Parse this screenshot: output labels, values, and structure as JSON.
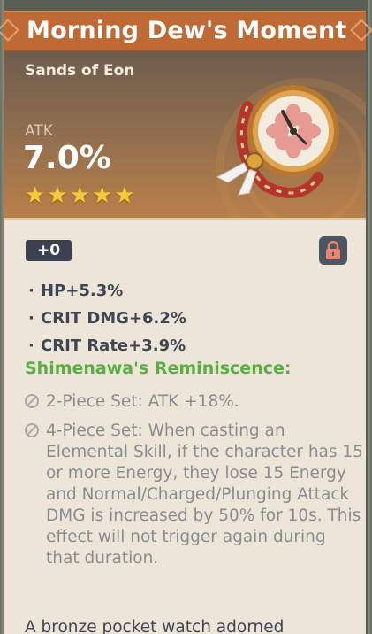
{
  "title": "Morning Dew's Moment",
  "set_name": "Sands of Eon",
  "main_stat": {
    "label": "ATK",
    "value": "7.0%"
  },
  "rarity_stars": 5,
  "level": "+0",
  "locked": true,
  "substats": [
    {
      "text": "HP+5.3%"
    },
    {
      "text": "CRIT DMG+6.2%"
    },
    {
      "text": "CRIT Rate+3.9%"
    }
  ],
  "set_bonus": {
    "title": "Shimenawa's Reminiscence:",
    "effects": [
      {
        "text": "2-Piece Set: ATK +18%."
      },
      {
        "text": "4-Piece Set: When casting an Elemental Skill, if the character has 15 or more Energy, they lose 15 Energy and Normal/Charged/Plunging Attack DMG is increased by 50% for 10s. This effect will not trigger again during that duration."
      }
    ]
  },
  "description": "A bronze pocket watch adorned",
  "colors": {
    "title_bar": "#bf6a34",
    "set_title": "#5cad45",
    "star": "#f6c83a",
    "body_bg": "#ece5d8"
  },
  "icons": {
    "lock": "lock-icon",
    "inactive": "inactive-circle-icon",
    "artifact": "pocket-watch-icon"
  }
}
